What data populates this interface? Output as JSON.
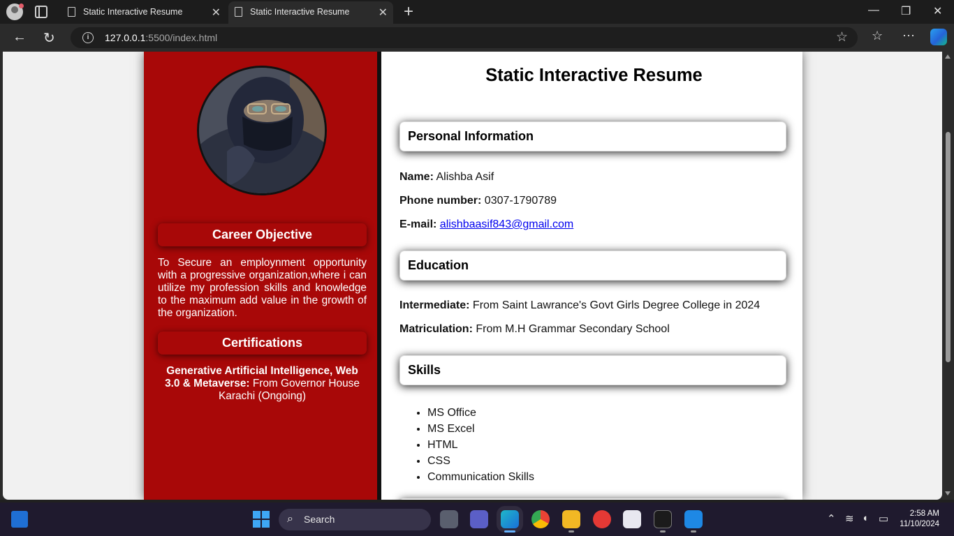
{
  "browser": {
    "tabs": [
      {
        "title": "Static Interactive Resume"
      },
      {
        "title": "Static Interactive Resume"
      }
    ],
    "url_host": "127.0.0.1",
    "url_rest": ":5500/index.html"
  },
  "resume": {
    "page_title": "Static Interactive Resume",
    "left": {
      "career_heading": "Career Objective",
      "career_text": "To Secure an employnment opportunity with a progressive organization,where i can utilize my profession skills and knowl­edge to the maximum add value in the growth of the organization.",
      "cert_heading": "Certifications",
      "cert_title": "Generative Artificial Intelligence, Web 3.0 & Metaverse:",
      "cert_detail": " From Governor House Karachi (Ongoing)"
    },
    "personal": {
      "heading": "Personal Information",
      "name_label": "Name:",
      "name_value": " Alishba Asif",
      "phone_label": "Phone number:",
      "phone_value": " 0307-1790789",
      "email_label": "E-mail:",
      "email_value": "alishbaasif843@gmail.com"
    },
    "education": {
      "heading": "Education",
      "inter_label": "Intermediate:",
      "inter_value": " From Saint Lawrance's Govt Girls Degree College in 2024",
      "matric_label": "Matriculation:",
      "matric_value": " From M.H Grammar Secondary School"
    },
    "skills": {
      "heading": "Skills",
      "items": [
        "MS Office",
        "MS Excel",
        "HTML",
        "CSS",
        "Communication Skills"
      ]
    }
  },
  "taskbar": {
    "search_label": "Search",
    "time": "2:58 AM",
    "date": "11/10/2024"
  },
  "colors": {
    "sidebar_red": "#a80808",
    "link_blue": "#0000ee",
    "taskbar_bg": "#1f1a2e"
  }
}
